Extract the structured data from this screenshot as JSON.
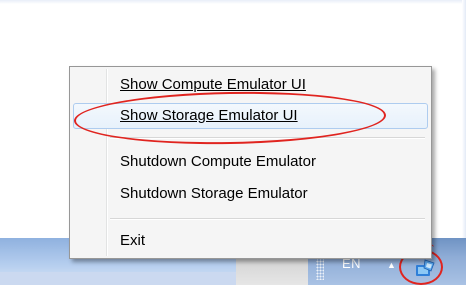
{
  "tray": {
    "language": "EN",
    "overflow_arrow": "▲"
  },
  "context_menu": {
    "items": [
      {
        "label": "Show Compute Emulator UI",
        "accel": "C"
      },
      {
        "label": "Show Storage Emulator UI",
        "accel": "S"
      },
      {
        "label": "Shutdown Compute Emulator"
      },
      {
        "label": "Shutdown Storage Emulator"
      },
      {
        "label": "Exit"
      }
    ],
    "highlighted_index": 1
  },
  "colors": {
    "annotation_red": "#e0241f",
    "menu_background": "#f5f5f5",
    "highlight_border": "#aeccef"
  },
  "icons": [
    "azure-emulator-tray-icon",
    "overflow-arrow-icon",
    "grip-icon"
  ]
}
